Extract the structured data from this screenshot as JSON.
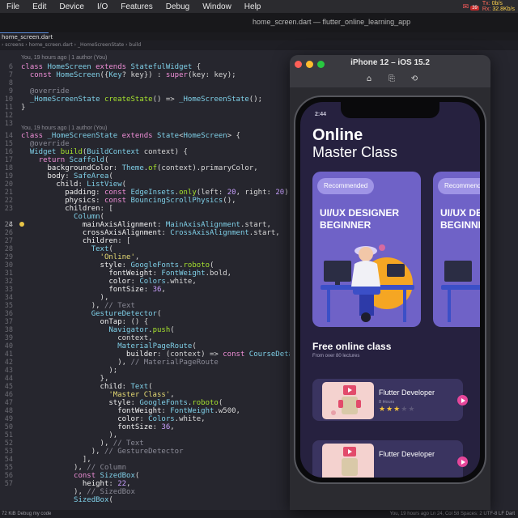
{
  "menubar": {
    "items": [
      "File",
      "Edit",
      "Device",
      "I/O",
      "Features",
      "Debug",
      "Window",
      "Help"
    ],
    "tx_label": "Tx:",
    "tx_value": "0b/s",
    "rx_label": "Rx:",
    "rx_value": "32.8Kb/s",
    "notif_count": "39"
  },
  "editor": {
    "window_title": "home_screen.dart — flutter_online_learning_app",
    "active_tab": "home_screen.dart",
    "breadcrumb": "› screens › home_screen.dart › _HomeScreenState › build"
  },
  "code": {
    "blame1": "You, 19 hours ago | 1 author (You)",
    "blame2": "You, 19 hours ago | 1 author (You)",
    "line_numbers": [
      "6",
      "7",
      "8",
      "9",
      "10",
      "11",
      "12",
      "13",
      "14",
      "15",
      "16",
      "17",
      "18",
      "19",
      "20",
      "21",
      "22",
      "23",
      "24",
      "25",
      "26",
      "27",
      "28",
      "29",
      "30",
      "31",
      "32",
      "33",
      "34",
      "35",
      "36",
      "37",
      "38",
      "39",
      "40",
      "41",
      "42",
      "43",
      "44",
      "45",
      "46",
      "47",
      "48",
      "49",
      "50",
      "51",
      "52",
      "53",
      "54",
      "55",
      "56",
      "57"
    ]
  },
  "statusbar": {
    "left": "72 KiB   Debug my code",
    "right": "You, 19 hours ago   Ln 24, Col 58   Spaces: 2   UTF-8   LF   Dart"
  },
  "simulator": {
    "title": "iPhone 12 – iOS 15.2",
    "icons": [
      "home-icon",
      "screenshot-icon",
      "rotate-icon"
    ]
  },
  "app": {
    "time": "2:44",
    "title_line1": "Online",
    "title_line2": "Master Class",
    "cards": [
      {
        "badge": "Recommended",
        "title": "UI/UX DESIGNER BEGINNER"
      },
      {
        "badge": "Recommended",
        "title": "UI/UX DESIGNER BEGINNER"
      }
    ],
    "section_title": "Free online class",
    "section_subtitle": "From over 80 lectures",
    "courses": [
      {
        "name": "Flutter Developer",
        "hours": "8 Hours",
        "rating": 3,
        "max_rating": 5
      },
      {
        "name": "Flutter Developer",
        "hours": "",
        "rating": 0,
        "max_rating": 5
      }
    ],
    "colors": {
      "background": "#26213f",
      "card": "#6f62c7",
      "accent": "#e5469a",
      "star": "#f5c33b"
    }
  }
}
